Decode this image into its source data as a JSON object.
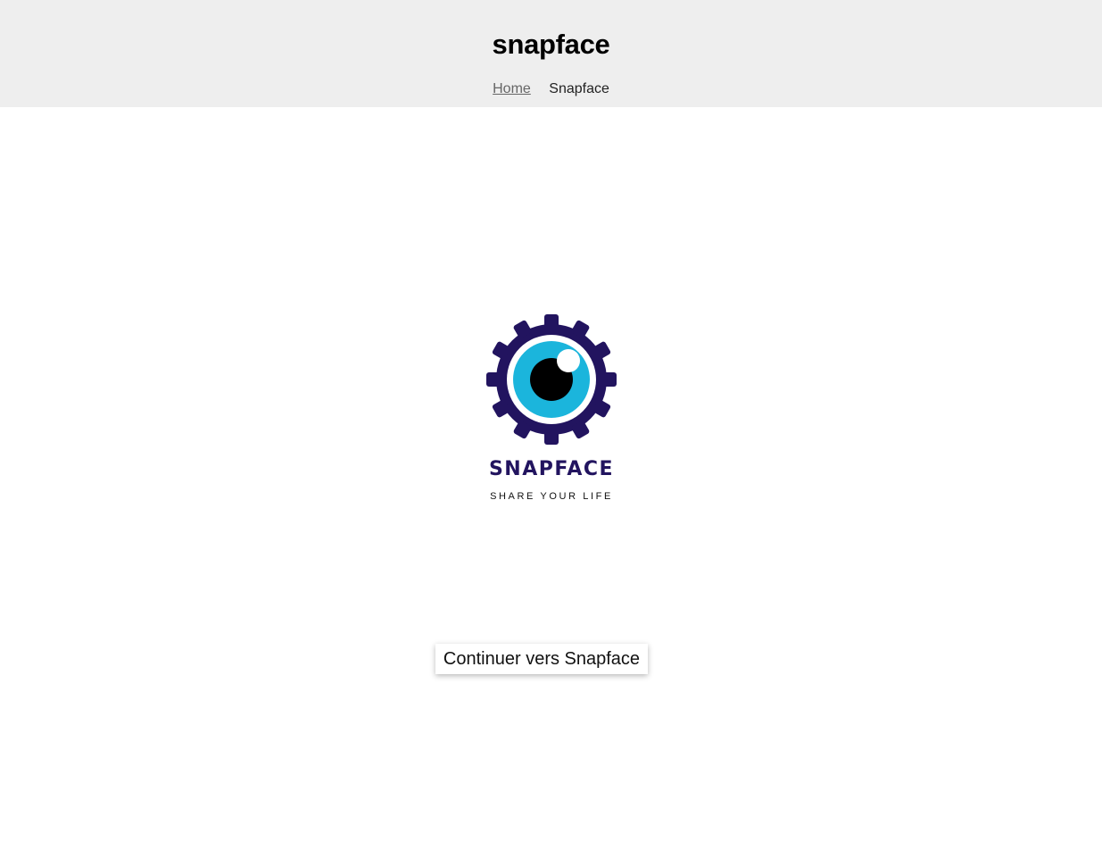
{
  "header": {
    "title": "snapface",
    "background": "#eeeeee",
    "nav": {
      "home_label": "Home",
      "snapface_label": "Snapface"
    }
  },
  "logo": {
    "brand_name": "SNAPFACE",
    "tagline": "SHARE YOUR LIFE",
    "colors": {
      "gear": "#22145f",
      "iris": "#1bb5dc",
      "pupil": "#000000",
      "highlight": "#ffffff"
    },
    "icon": "gear-eye-icon"
  },
  "main": {
    "continue_label": "Continuer vers Snapface"
  }
}
